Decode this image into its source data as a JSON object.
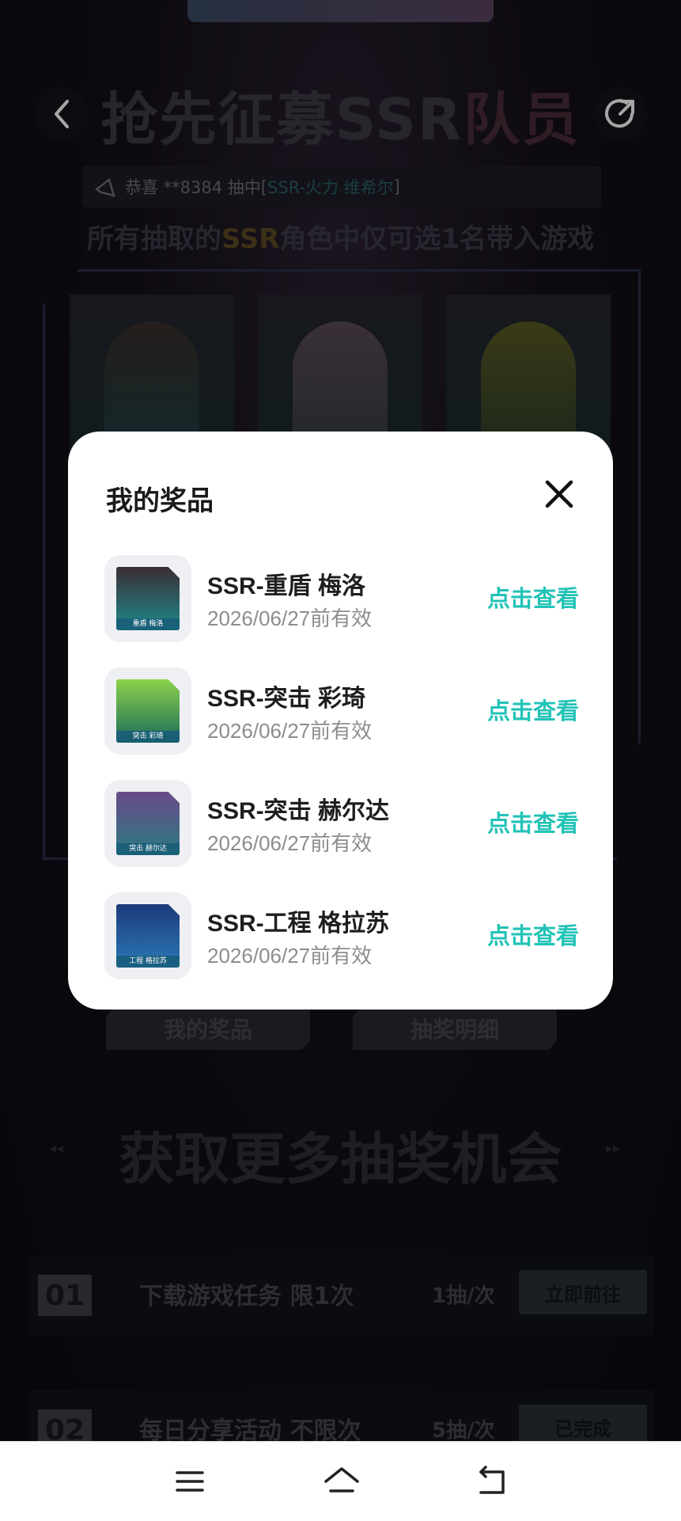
{
  "header": {
    "title_main": "抢先征募SSR",
    "title_accent": "队员"
  },
  "notice": {
    "prefix": "恭喜 **8384 抽中[ ",
    "highlight": "SSR-火力 维希尔",
    "suffix": " ]"
  },
  "subtitle": {
    "part1": "所有抽取的",
    "ssr": "SSR",
    "part2": "角色中仅可选1名带入游戏"
  },
  "buttons": {
    "my_prizes": "我的奖品",
    "draw_details": "抽奖明细"
  },
  "section2_title": "获取更多抽奖机会",
  "tasks": [
    {
      "num": "01",
      "label": "下载游戏任务 限1次",
      "rate": "1抽/次",
      "action": "立即前往"
    },
    {
      "num": "02",
      "label": "每日分享活动 不限次",
      "rate": "5抽/次",
      "action": "已完成"
    }
  ],
  "modal": {
    "title": "我的奖品",
    "view_label": "点击查看",
    "items": [
      {
        "name": "SSR-重盾 梅洛",
        "date": "2026/06/27前有效",
        "tag": "重盾 梅洛",
        "color": "#1d8a8a"
      },
      {
        "name": "SSR-突击 彩琦",
        "date": "2026/06/27前有效",
        "tag": "突击 彩琦",
        "color": "#7bc23a"
      },
      {
        "name": "SSR-突击 赫尔达",
        "date": "2026/06/27前有效",
        "tag": "突击 赫尔达",
        "color": "#6a4a8a"
      },
      {
        "name": "SSR-工程 格拉苏",
        "date": "2026/06/27前有效",
        "tag": "工程 格拉苏",
        "color": "#2b63b8"
      }
    ]
  },
  "colors": {
    "accent": "#22c3b7",
    "modal_bg": "#ffffff",
    "page_bg": "#0d0f14"
  }
}
